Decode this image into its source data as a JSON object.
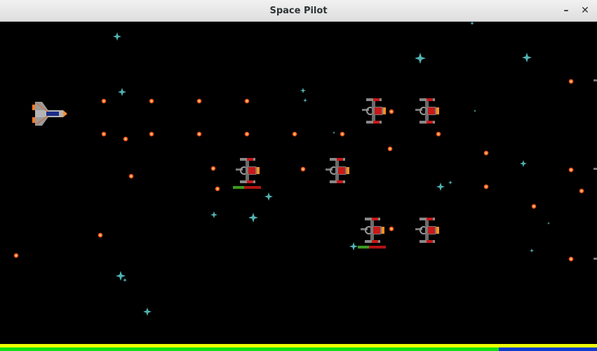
{
  "window": {
    "title": "Space Pilot",
    "minimize_glyph": "–",
    "close_glyph": "✕"
  },
  "colors": {
    "bullet": "#ff5a1e",
    "star": "#5fd2d2",
    "health_green": "#3c9a20",
    "health_red": "#b01414",
    "shield": "#f0ff00",
    "energy": "#10e010",
    "energy_depleted": "#0a3cd0"
  },
  "player": {
    "ship": "player-fighter-icon"
  },
  "enemies": [
    {
      "ship": "enemy-fighter-icon",
      "health": null
    },
    {
      "ship": "enemy-fighter-icon",
      "health": null
    },
    {
      "ship": "enemy-fighter-icon",
      "health": 0.4
    },
    {
      "ship": "enemy-fighter-icon",
      "health": null
    },
    {
      "ship": "enemy-fighter-icon",
      "health": 0.4
    },
    {
      "ship": "enemy-fighter-icon",
      "health": null
    }
  ],
  "hud": {
    "shield_level": 1.0,
    "energy_level": 0.835
  }
}
